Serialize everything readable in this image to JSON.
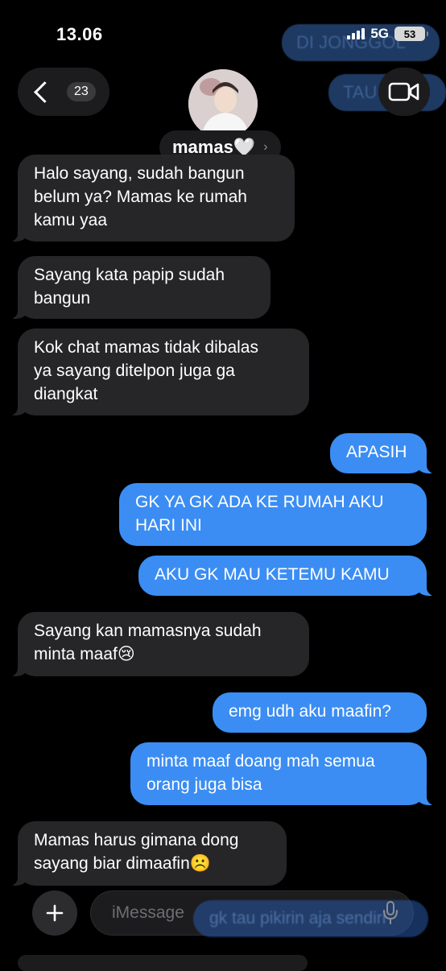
{
  "status_bar": {
    "time": "13.06",
    "network": "5G",
    "battery": "53"
  },
  "ghost_overlays": {
    "top": "DI JONGGOL",
    "top2": "TAU",
    "bottom": "gk tau pikirin aja sendiri"
  },
  "header": {
    "back_count": "23",
    "contact_name": "mamas🤍"
  },
  "messages": [
    {
      "direction": "in",
      "text": "Halo sayang, sudah bangun\nbelum ya? Mamas ke rumah\nkamu yaa"
    },
    {
      "direction": "in",
      "text": "Sayang kata papip sudah\nbangun"
    },
    {
      "direction": "in",
      "text": "Kok chat mamas tidak dibalas\nya sayang ditelpon juga ga\ndiangkat"
    },
    {
      "direction": "out",
      "text": "APASIH"
    },
    {
      "direction": "out",
      "text": "GK YA GK ADA KE RUMAH AKU\nHARI INI"
    },
    {
      "direction": "out",
      "text": "AKU GK MAU KETEMU KAMU"
    },
    {
      "direction": "in",
      "text": "Sayang kan mamasnya sudah\nminta maaf😢"
    },
    {
      "direction": "out",
      "text": "emg udh aku maafin?"
    },
    {
      "direction": "out",
      "text": "minta maaf doang mah semua\norang juga bisa"
    },
    {
      "direction": "in",
      "text": "Mamas harus gimana dong\nsayang biar dimaafin☹️"
    }
  ],
  "input": {
    "placeholder": "iMessage"
  },
  "colors": {
    "incoming_bubble": "#262628",
    "outgoing_bubble": "#3b8df3",
    "background": "#000000"
  },
  "icons": [
    "back-chevron-icon",
    "video-camera-icon",
    "plus-icon",
    "microphone-icon",
    "heart-icon"
  ]
}
